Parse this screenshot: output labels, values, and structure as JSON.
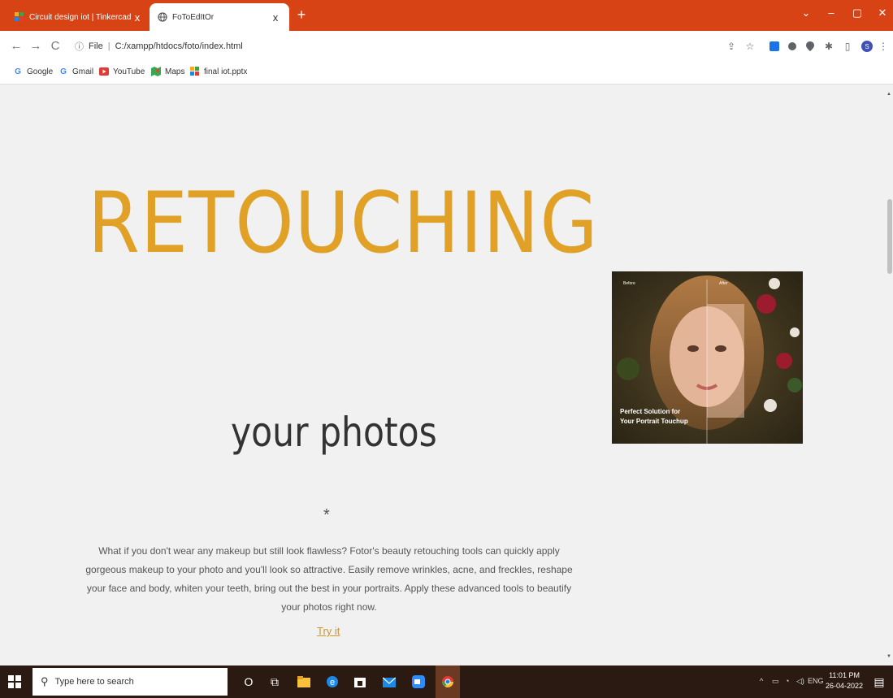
{
  "browser": {
    "tabs": [
      {
        "title": "Circuit design iot | Tinkercad",
        "active": false
      },
      {
        "title": "FoToEdItOr",
        "active": true
      }
    ],
    "new_tab_label": "+",
    "close_label": "x",
    "address": {
      "scheme": "File",
      "path": "C:/xampp/htdocs/foto/index.html"
    },
    "bookmarks": [
      "Google",
      "Gmail",
      "YouTube",
      "Maps",
      "final iot.pptx"
    ]
  },
  "page": {
    "hero_title": "RETOUCHING",
    "subtitle": "your photos",
    "ornament": "*",
    "description": "What if you don't wear any makeup but still look flawless? Fotor's beauty retouching tools can quickly apply gorgeous makeup to your photo and you'll look so attractive. Easily remove wrinkles, acne, and freckles, reshape your face and body, whiten your teeth, bring out the best in your portraits. Apply these advanced tools to beautify your photos right now.",
    "cta": "Try it",
    "photo": {
      "before_label": "Before",
      "after_label": "After",
      "caption_line1": "Perfect Solution for",
      "caption_line2": "Your Portrait Touchup"
    }
  },
  "taskbar": {
    "search_placeholder": "Type here to search",
    "language": "ENG",
    "time": "11:01 PM",
    "date": "26-04-2022"
  },
  "colors": {
    "tabstrip": "#d84315",
    "accent": "#e0a126",
    "taskbar": "#2b1a12"
  }
}
